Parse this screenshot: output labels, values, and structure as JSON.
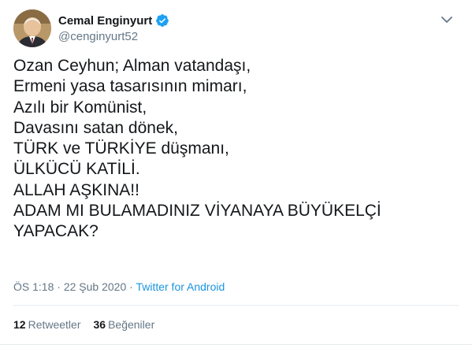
{
  "author": {
    "display_name": "Cemal Enginyurt",
    "username": "@cenginyurt52",
    "verified": true
  },
  "tweet": {
    "lines": [
      "Ozan Ceyhun; Alman vatandaşı,",
      "Ermeni yasa tasarısının mimarı,",
      "Azılı bir Komünist,",
      "Davasını satan dönek,",
      "TÜRK ve TÜRKİYE düşmanı,",
      "ÜLKÜCÜ KATİLİ.",
      "ALLAH AŞKINA!!",
      "ADAM MI BULAMADINIZ VİYANAYA BÜYÜKELÇİ",
      "YAPACAK?"
    ]
  },
  "meta": {
    "time": "ÖS 1:18",
    "separator1": " · ",
    "date": "22 Şub 2020",
    "separator2": " · ",
    "source": "Twitter for Android"
  },
  "stats": {
    "retweets_count": "12",
    "retweets_label": "Retweetler",
    "likes_count": "36",
    "likes_label": "Beğeniler"
  },
  "icons": {
    "verified": "verified-badge-icon",
    "menu": "chevron-down-icon"
  },
  "colors": {
    "verified": "#1da1f2",
    "link": "#1b95e0",
    "muted": "#657786",
    "text": "#14171a",
    "border": "#e6ecf0"
  }
}
